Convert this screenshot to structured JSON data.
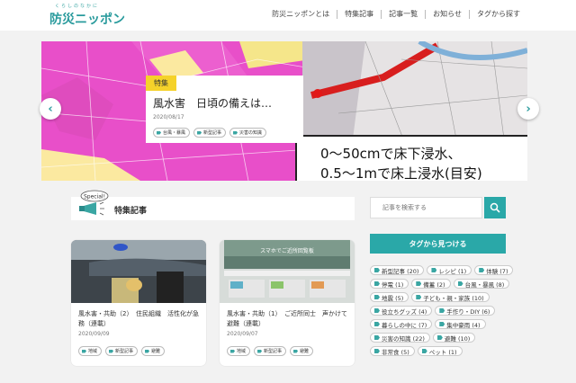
{
  "logo": {
    "tagline": "くらしのなかに",
    "name": "防災ニッポン"
  },
  "nav": [
    "防災ニッポンとは",
    "特集記事",
    "記事一覧",
    "お知らせ",
    "タグから探す"
  ],
  "hero": {
    "map_text_line1": "0〜50cmで床下浸水、",
    "map_text_line2": "0.5〜1mで床上浸水(目安)",
    "feature": {
      "label": "特集",
      "title": "風水害　日頃の備えは…",
      "date": "2020/08/17",
      "tags": [
        "台風・暴風",
        "新型記事",
        "災害の知識"
      ]
    },
    "prev_arrow": "‹",
    "next_arrow": "›"
  },
  "section": {
    "badge": "Special!",
    "title": "特集記事"
  },
  "search": {
    "placeholder": "記事を検索する"
  },
  "tag_panel": {
    "header": "タグから見つける",
    "tags": [
      "新型記事 (20)",
      "レシピ (1)",
      "体験 (7)",
      "停電 (1)",
      "備蓄 (2)",
      "台風・暴風 (8)",
      "地震 (5)",
      "子ども・親・家族 (10)",
      "役立ちグッズ (4)",
      "手作り・DIY (6)",
      "暮らしの中に (7)",
      "集中豪雨 (4)",
      "災害の知識 (22)",
      "避難 (10)",
      "非常食 (5)",
      "ペット (1)"
    ]
  },
  "articles": [
    {
      "title": "風水害・共助（2）　住民組織　活性化が急務（連載）",
      "date": "2020/09/09",
      "tags": [
        "地域",
        "新型記事",
        "避難"
      ]
    },
    {
      "title": "風水害・共助（1）　ご近所同士　声かけて避難（連載）",
      "date": "2020/09/07",
      "tags": [
        "地域",
        "新型記事",
        "避難"
      ]
    }
  ],
  "colors": {
    "brand": "#2aa8a8",
    "accent": "#f5d22a",
    "flood_map_pink": "#e84fc9"
  }
}
